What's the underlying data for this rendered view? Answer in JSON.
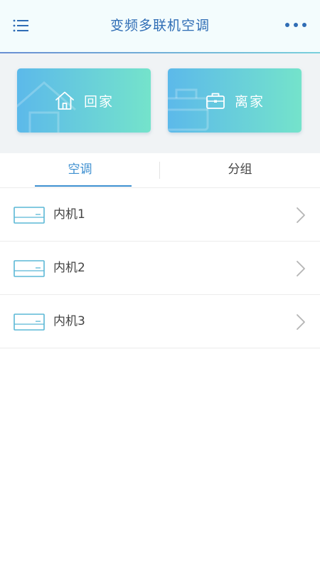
{
  "header": {
    "title": "变频多联机空调",
    "menu_icon": "list-menu-icon",
    "more_icon": "more-dots-icon",
    "title_color": "#2f6db5"
  },
  "modes": {
    "home": {
      "label": "回家",
      "icon": "house-icon"
    },
    "away": {
      "label": "离家",
      "icon": "briefcase-icon"
    },
    "gradient": [
      "#5cb9ea",
      "#74e3cb"
    ]
  },
  "tabs": [
    {
      "label": "空调",
      "active": true
    },
    {
      "label": "分组",
      "active": false
    }
  ],
  "accent_color": "#3d8fd0",
  "units": [
    {
      "label": "内机1",
      "icon": "ac-unit-icon"
    },
    {
      "label": "内机2",
      "icon": "ac-unit-icon"
    },
    {
      "label": "内机3",
      "icon": "ac-unit-icon"
    }
  ]
}
